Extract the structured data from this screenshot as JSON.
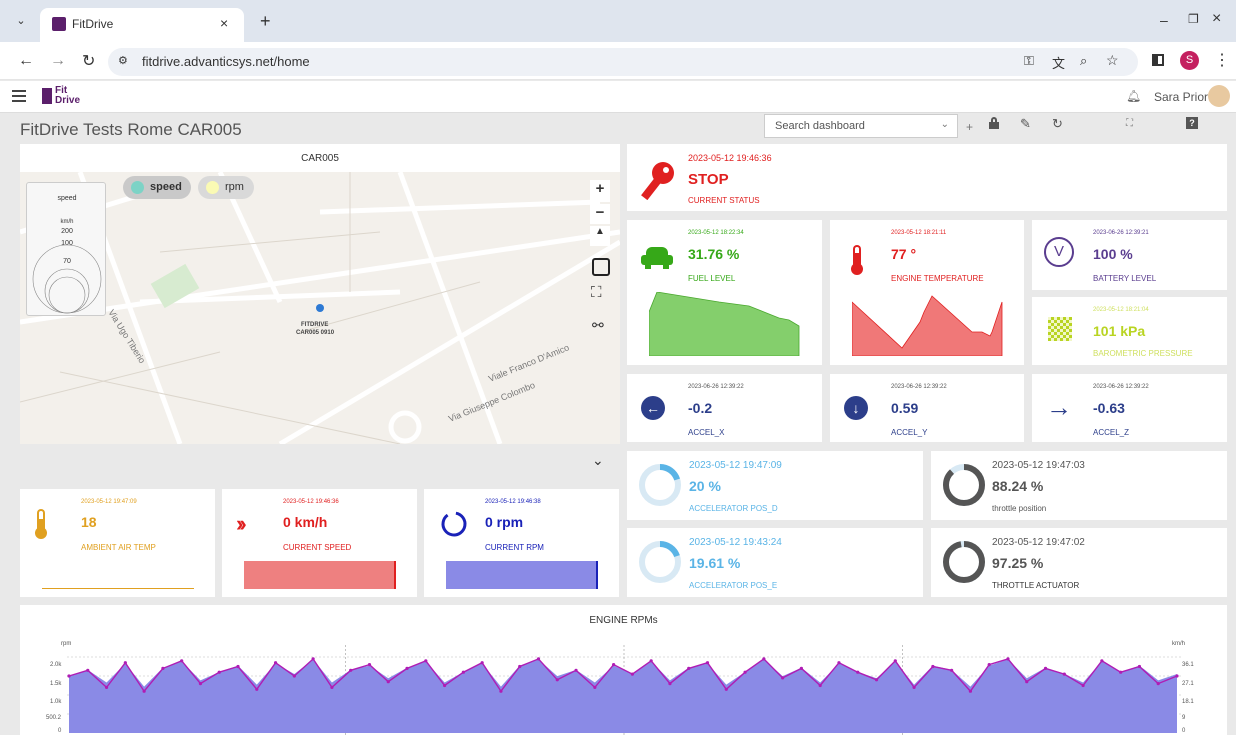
{
  "browser": {
    "tab_title": "FitDrive",
    "url": "fitdrive.advanticsys.net/home",
    "profile_initial": "S"
  },
  "app": {
    "logo_line1": "Fit",
    "logo_line2": "Drive",
    "user_name": "Sara Prior",
    "dashboard_title": "FitDrive Tests Rome CAR005",
    "search_placeholder": "Search dashboard"
  },
  "map": {
    "title": "CAR005",
    "legend": [
      {
        "label": "speed",
        "color": "#7dd3c6"
      },
      {
        "label": "rpm",
        "color": "#fafab4"
      }
    ],
    "scale_title": "speed",
    "scale_unit": "km/h",
    "scale_values": [
      "200",
      "100",
      "70"
    ],
    "marker_label_1": "FITDRIVE",
    "marker_label_2": "CAR005 0910",
    "streets": [
      "Via Ugo Tiberio",
      "Viale Franco D'Amico",
      "Via Giuseppe Colombo"
    ]
  },
  "status": {
    "time": "2023-05-12 19:46:36",
    "value": "STOP",
    "label": "CURRENT STATUS",
    "color": "#e02020"
  },
  "tiles": {
    "fuel": {
      "time": "2023-05-12 18:22:34",
      "value": "31.76 %",
      "label": "FUEL LEVEL",
      "color": "#36a818"
    },
    "engine_temp": {
      "time": "2023-05-12 18:21:11",
      "value": "77 °",
      "label": "ENGINE TEMPERATURE",
      "color": "#e02020"
    },
    "battery": {
      "time": "2023-06-26 12:39:21",
      "value": "100 %",
      "label": "BATTERY LEVEL",
      "color": "#5a3d8f"
    },
    "baro": {
      "time": "2023-05-12 18:21:04",
      "value": "101 kPa",
      "label": "BAROMETRIC PRESSURE",
      "color": "#b9d422"
    },
    "accel_x": {
      "time": "2023-06-26 12:39:22",
      "value": "-0.2",
      "label": "ACCEL_X",
      "color": "#2c3e8a"
    },
    "accel_y": {
      "time": "2023-06-26 12:39:22",
      "value": "0.59",
      "label": "ACCEL_Y",
      "color": "#2c3e8a"
    },
    "accel_z": {
      "time": "2023-06-26 12:39:22",
      "value": "-0.63",
      "label": "ACCEL_Z",
      "color": "#2c3e8a"
    },
    "ambient": {
      "time": "2023-05-12 19:47:09",
      "value": "18",
      "label": "AMBIENT AIR TEMP",
      "color": "#e0a020"
    },
    "speed": {
      "time": "2023-05-12 19:46:36",
      "value": "0 km/h",
      "label": "CURRENT SPEED",
      "color": "#e02020"
    },
    "rpm": {
      "time": "2023-05-12 19:46:38",
      "value": "0 rpm",
      "label": "CURRENT RPM",
      "color": "#1a22b8"
    }
  },
  "gauges": [
    {
      "time": "2023-05-12 19:47:09",
      "value": "20 %",
      "label": "ACCELERATOR POS_D",
      "color": "#5ab4e6",
      "level": 0.2
    },
    {
      "time": "2023-05-12 19:47:03",
      "value": "88.24 %",
      "label": "throttle position",
      "color": "#555555",
      "level": 0.8824
    },
    {
      "time": "2023-05-12 19:43:24",
      "value": "19.61 %",
      "label": "ACCELERATOR POS_E",
      "color": "#5ab4e6",
      "level": 0.1961
    },
    {
      "time": "2023-05-12 19:47:02",
      "value": "97.25 %",
      "label": "THROTTLE ACTUATOR",
      "color": "#555555",
      "level": 0.9725
    }
  ],
  "engine_chart": {
    "title": "ENGINE RPMs",
    "left_unit": "rpm",
    "right_unit": "km/h",
    "left_ticks": [
      "2.0k",
      "1.5k",
      "1.0k",
      "500.2",
      "0"
    ],
    "right_ticks": [
      "36.1",
      "27.1",
      "18.1",
      "9",
      "0"
    ]
  },
  "chart_data": {
    "type": "area",
    "title": "ENGINE RPMs",
    "ylabel": "rpm",
    "y2label": "km/h",
    "ylim": [
      0,
      2000
    ],
    "y2lim": [
      0,
      36.1
    ],
    "series": [
      {
        "name": "rpm",
        "color": "#b01cb4",
        "values": [
          1500,
          1650,
          1200,
          1850,
          1100,
          1700,
          1900,
          1300,
          1600,
          1750,
          1150,
          1850,
          1500,
          1950,
          1200,
          1650,
          1800,
          1350,
          1700,
          1900,
          1250,
          1600,
          1850,
          1100,
          1750,
          1950,
          1400,
          1650,
          1200,
          1800,
          1550,
          1900,
          1300,
          1700,
          1850,
          1150,
          1600,
          1950,
          1450,
          1700,
          1250,
          1850,
          1600,
          1400,
          1900,
          1200,
          1750,
          1650,
          1100,
          1800,
          1950,
          1350,
          1700,
          1550,
          1250,
          1900,
          1600,
          1750,
          1300,
          1500
        ]
      },
      {
        "name": "speed",
        "color": "#8a8ae6",
        "values": [
          27,
          30,
          24,
          33,
          22,
          31,
          34,
          25,
          29,
          32,
          23,
          33,
          28,
          35,
          24,
          30,
          32,
          26,
          31,
          34,
          24,
          29,
          33,
          22,
          32,
          35,
          27,
          30,
          24,
          32,
          28,
          34,
          25,
          31,
          33,
          23,
          29,
          35,
          27,
          31,
          24,
          33,
          29,
          26,
          34,
          23,
          32,
          30,
          22,
          32,
          35,
          26,
          31,
          28,
          24,
          34,
          29,
          32,
          25,
          28
        ]
      }
    ]
  }
}
